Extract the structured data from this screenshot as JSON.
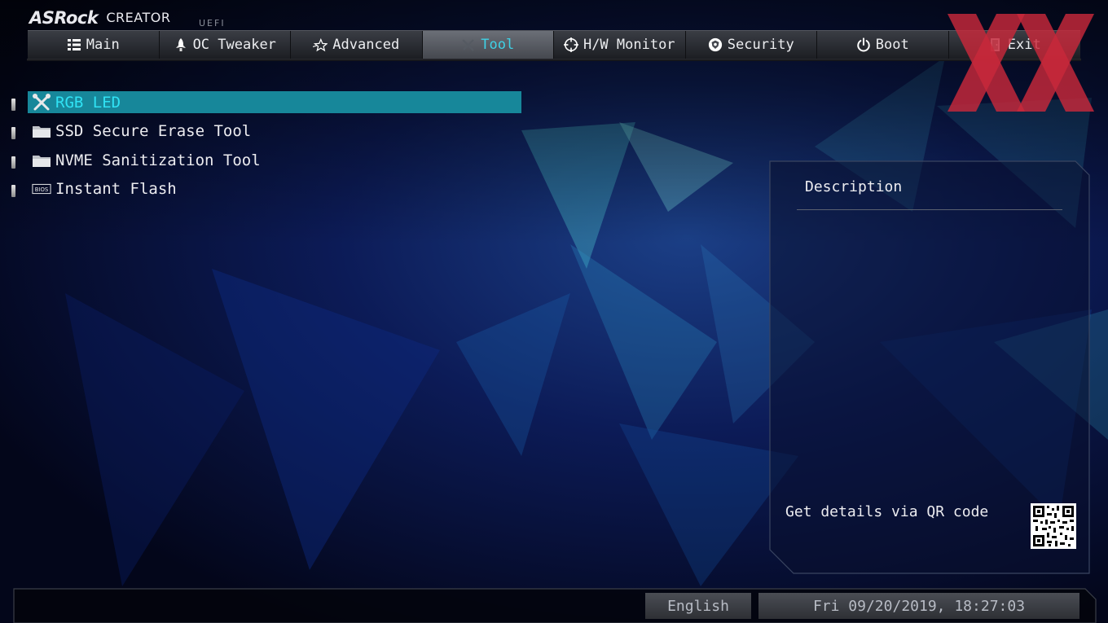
{
  "brand": {
    "name": "ASRock",
    "edition": "CREATOR",
    "sub": "UEFI"
  },
  "tabs": [
    {
      "label": "Main",
      "icon": "list-icon"
    },
    {
      "label": "OC Tweaker",
      "icon": "rocket-icon"
    },
    {
      "label": "Advanced",
      "icon": "star-icon"
    },
    {
      "label": "Tool",
      "icon": "tools-icon",
      "active": true
    },
    {
      "label": "H/W Monitor",
      "icon": "crosshair-icon"
    },
    {
      "label": "Security",
      "icon": "shield-icon"
    },
    {
      "label": "Boot",
      "icon": "power-icon"
    },
    {
      "label": "Exit",
      "icon": "exit-door-icon"
    }
  ],
  "tool_list": [
    {
      "label": "RGB LED",
      "icon": "wrench-screwdriver-icon",
      "selected": true
    },
    {
      "label": "SSD Secure Erase Tool",
      "icon": "folder-icon"
    },
    {
      "label": "NVME Sanitization Tool",
      "icon": "folder-icon"
    },
    {
      "label": "Instant Flash",
      "icon": "bios-chip-icon",
      "icon_text": "BIOS"
    }
  ],
  "description": {
    "title": "Description",
    "qr_text": "Get details via QR code"
  },
  "footer": {
    "language": "English",
    "datetime": "Fri 09/20/2019, 18:27:03"
  },
  "colors": {
    "accent": "#30e2f4",
    "highlight": "#17879a",
    "logo_red": "#c8283a",
    "background": "#050a1e"
  }
}
